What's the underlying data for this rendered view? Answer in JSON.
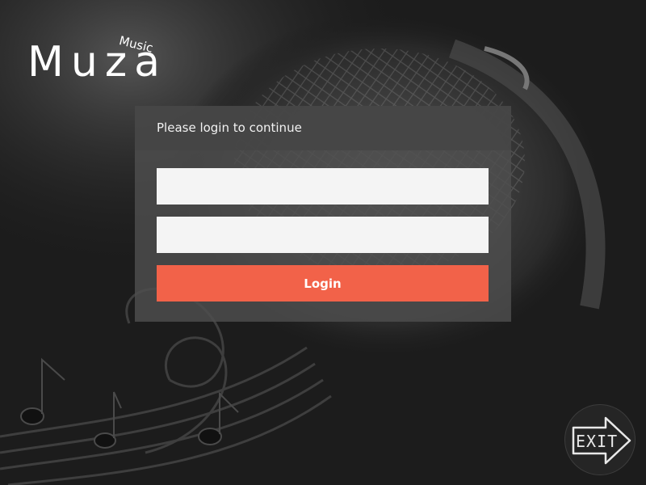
{
  "app": {
    "brand_name": "Muza",
    "brand_sub": "Music"
  },
  "login": {
    "header_text": "Please login to continue",
    "username_value": "",
    "password_value": "",
    "button_label": "Login"
  },
  "exit": {
    "label": "EXIT"
  },
  "colors": {
    "accent": "#f26249",
    "panel": "#4e4e4e",
    "field": "#f4f4f4",
    "background": "#1c1c1c"
  },
  "icons": [
    "music-note-icon",
    "exit-arrow-icon"
  ]
}
